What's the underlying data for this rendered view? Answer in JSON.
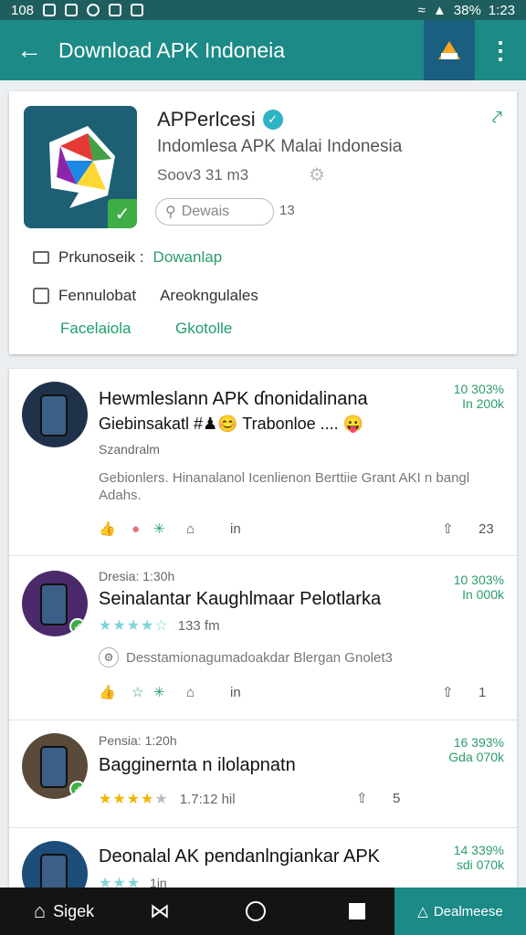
{
  "status_bar": {
    "left_time": "108",
    "right_text": "38%",
    "clock": "1:23"
  },
  "app_bar": {
    "title": "Download APK Indoneia",
    "back_icon": "arrow-left-icon",
    "warn_icon": "warning-icon",
    "more_icon": "more-vert-icon"
  },
  "app": {
    "name": "APPerlcesi",
    "subtitle": "Indomlesa APK Malai Indonesia",
    "size": "Soov3 31 m3",
    "search_placeholder": "Dewais",
    "search_count": "13",
    "row1_key": "Prkunoseik :",
    "row1_value": "Dowanlap",
    "row2_key": "Fennulobat",
    "row2_value": "Areokngulales",
    "link1": "Facelaiola",
    "link2": "Gkotolle",
    "accent": "#1c8a86",
    "badge_color": "#3fae46"
  },
  "reviews": [
    {
      "meta": "",
      "title": "Hewmleslann APK ɗnonidalinana",
      "title2": "Giebinsakatl #♟😊 Trabonloe ....  😛",
      "sub": "Szandralm",
      "stat1": "10  303%",
      "stat2": "In 200k",
      "body": "Gebionlers. Hinanalanol Icenlienon Berttiie Grant AKI  n  bangl Adahs.",
      "like": "",
      "reply": "in",
      "share_count": "23"
    },
    {
      "meta": "Dresia: 1:30h",
      "title": "Seinalantar Kaughlmaar Pelotlarka",
      "sub": "133 fm",
      "stat1": "10  303%",
      "stat2": "In 000k",
      "body": "Desstamionagumadoakdar Blergan Gnolet3",
      "reply": "in",
      "share_count": "1"
    },
    {
      "meta": "Pensia: 1:20h",
      "title": "Bagginernta n ilolapnatn",
      "sub": "1.7:12 hil",
      "stat1": "16  393%",
      "stat2": "Gda 070k",
      "share_count": "5"
    },
    {
      "meta": "",
      "title": "Deonalal AK pendanlngiankar APK",
      "sub": "1in",
      "stat1": "14  339%",
      "stat2": "sdi 070k"
    }
  ],
  "nav": {
    "home_label": "Sigek",
    "download_label": "Dealmeese"
  }
}
